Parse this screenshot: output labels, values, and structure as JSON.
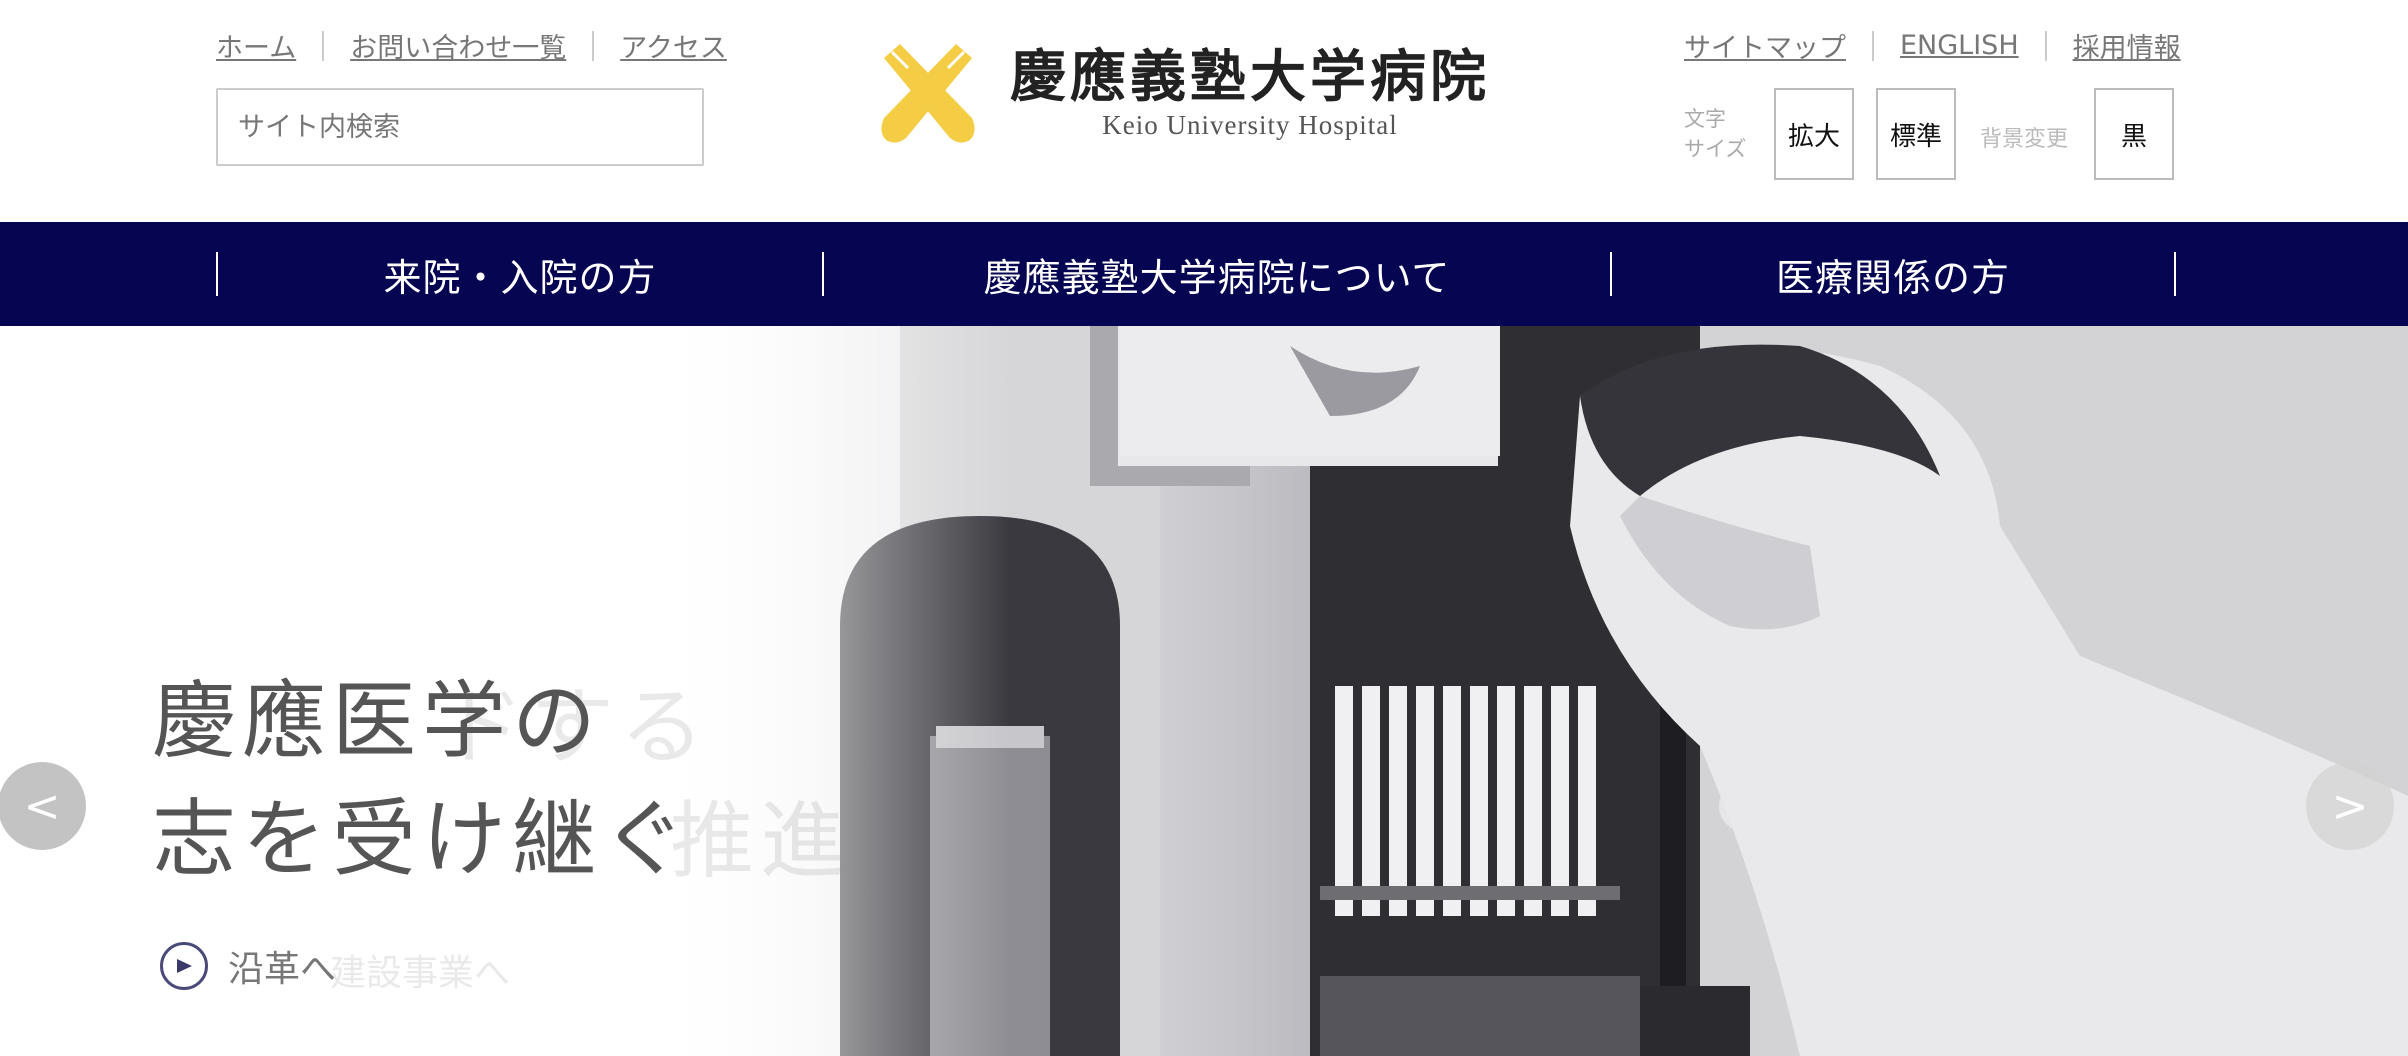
{
  "header": {
    "util_left": [
      "ホーム",
      "お問い合わせ一覧",
      "アクセス"
    ],
    "util_right": [
      "サイトマップ",
      "ENGLISH",
      "採用情報"
    ],
    "search_placeholder": "サイト内検索",
    "logo": {
      "name_ja": "慶應義塾大学病院",
      "name_en": "Keio University Hospital",
      "mark_color": "#f5cd45"
    },
    "font_size": {
      "label_line1": "文字",
      "label_line2": "サイズ",
      "enlarge": "拡大",
      "standard": "標準"
    },
    "background": {
      "label": "背景変更",
      "black": "黒"
    }
  },
  "nav": {
    "background_color": "#050552",
    "items": [
      "来院・入院の方",
      "慶應義塾大学病院について",
      "医療関係の方"
    ]
  },
  "hero": {
    "headline_line1": "慶應医学の",
    "headline_line2": "志を受け継ぐ",
    "link_label": "沿革へ",
    "ghost_line1": "ドする",
    "ghost_line2": "推進",
    "ghost_link": "建設事業へ",
    "prev_arrow": "<",
    "next_arrow": ">"
  }
}
